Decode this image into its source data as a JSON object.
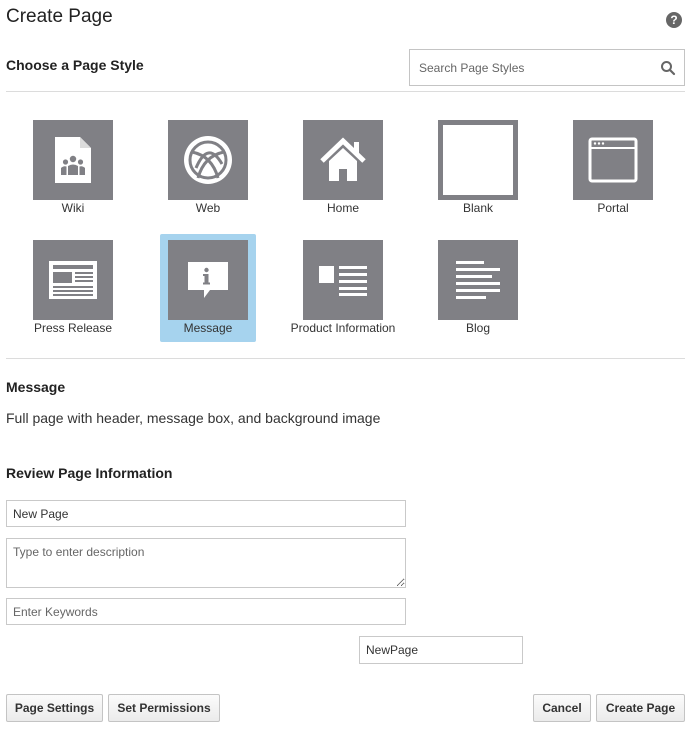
{
  "dialog": {
    "title": "Create Page",
    "help_icon": "?"
  },
  "style_section": {
    "heading": "Choose a Page Style",
    "search_placeholder": "Search Page Styles"
  },
  "styles": [
    {
      "label": "Wiki",
      "icon": "wiki-document-icon",
      "selected": false
    },
    {
      "label": "Web",
      "icon": "web-globe-icon",
      "selected": false
    },
    {
      "label": "Home",
      "icon": "home-icon",
      "selected": false
    },
    {
      "label": "Blank",
      "icon": "blank-page-icon",
      "selected": false
    },
    {
      "label": "Portal",
      "icon": "portal-window-icon",
      "selected": false
    },
    {
      "label": "Press Release",
      "icon": "press-release-icon",
      "selected": false
    },
    {
      "label": "Message",
      "icon": "message-info-icon",
      "selected": true
    },
    {
      "label": "Product Information",
      "icon": "product-information-icon",
      "selected": false
    },
    {
      "label": "Blog",
      "icon": "blog-text-icon",
      "selected": false
    }
  ],
  "selected_style": {
    "name": "Message",
    "description": "Full page with header, message box, and background image"
  },
  "review": {
    "heading": "Review Page Information",
    "page_name_value": "New Page",
    "description_placeholder": "Type to enter description",
    "keywords_placeholder": "Enter Keywords",
    "url_name_value": "NewPage"
  },
  "buttons": {
    "page_settings": "Page Settings",
    "set_permissions": "Set Permissions",
    "cancel": "Cancel",
    "create_page": "Create Page"
  },
  "colors": {
    "tile_gray": "#808085",
    "selected_highlight": "#a6d3ee"
  }
}
